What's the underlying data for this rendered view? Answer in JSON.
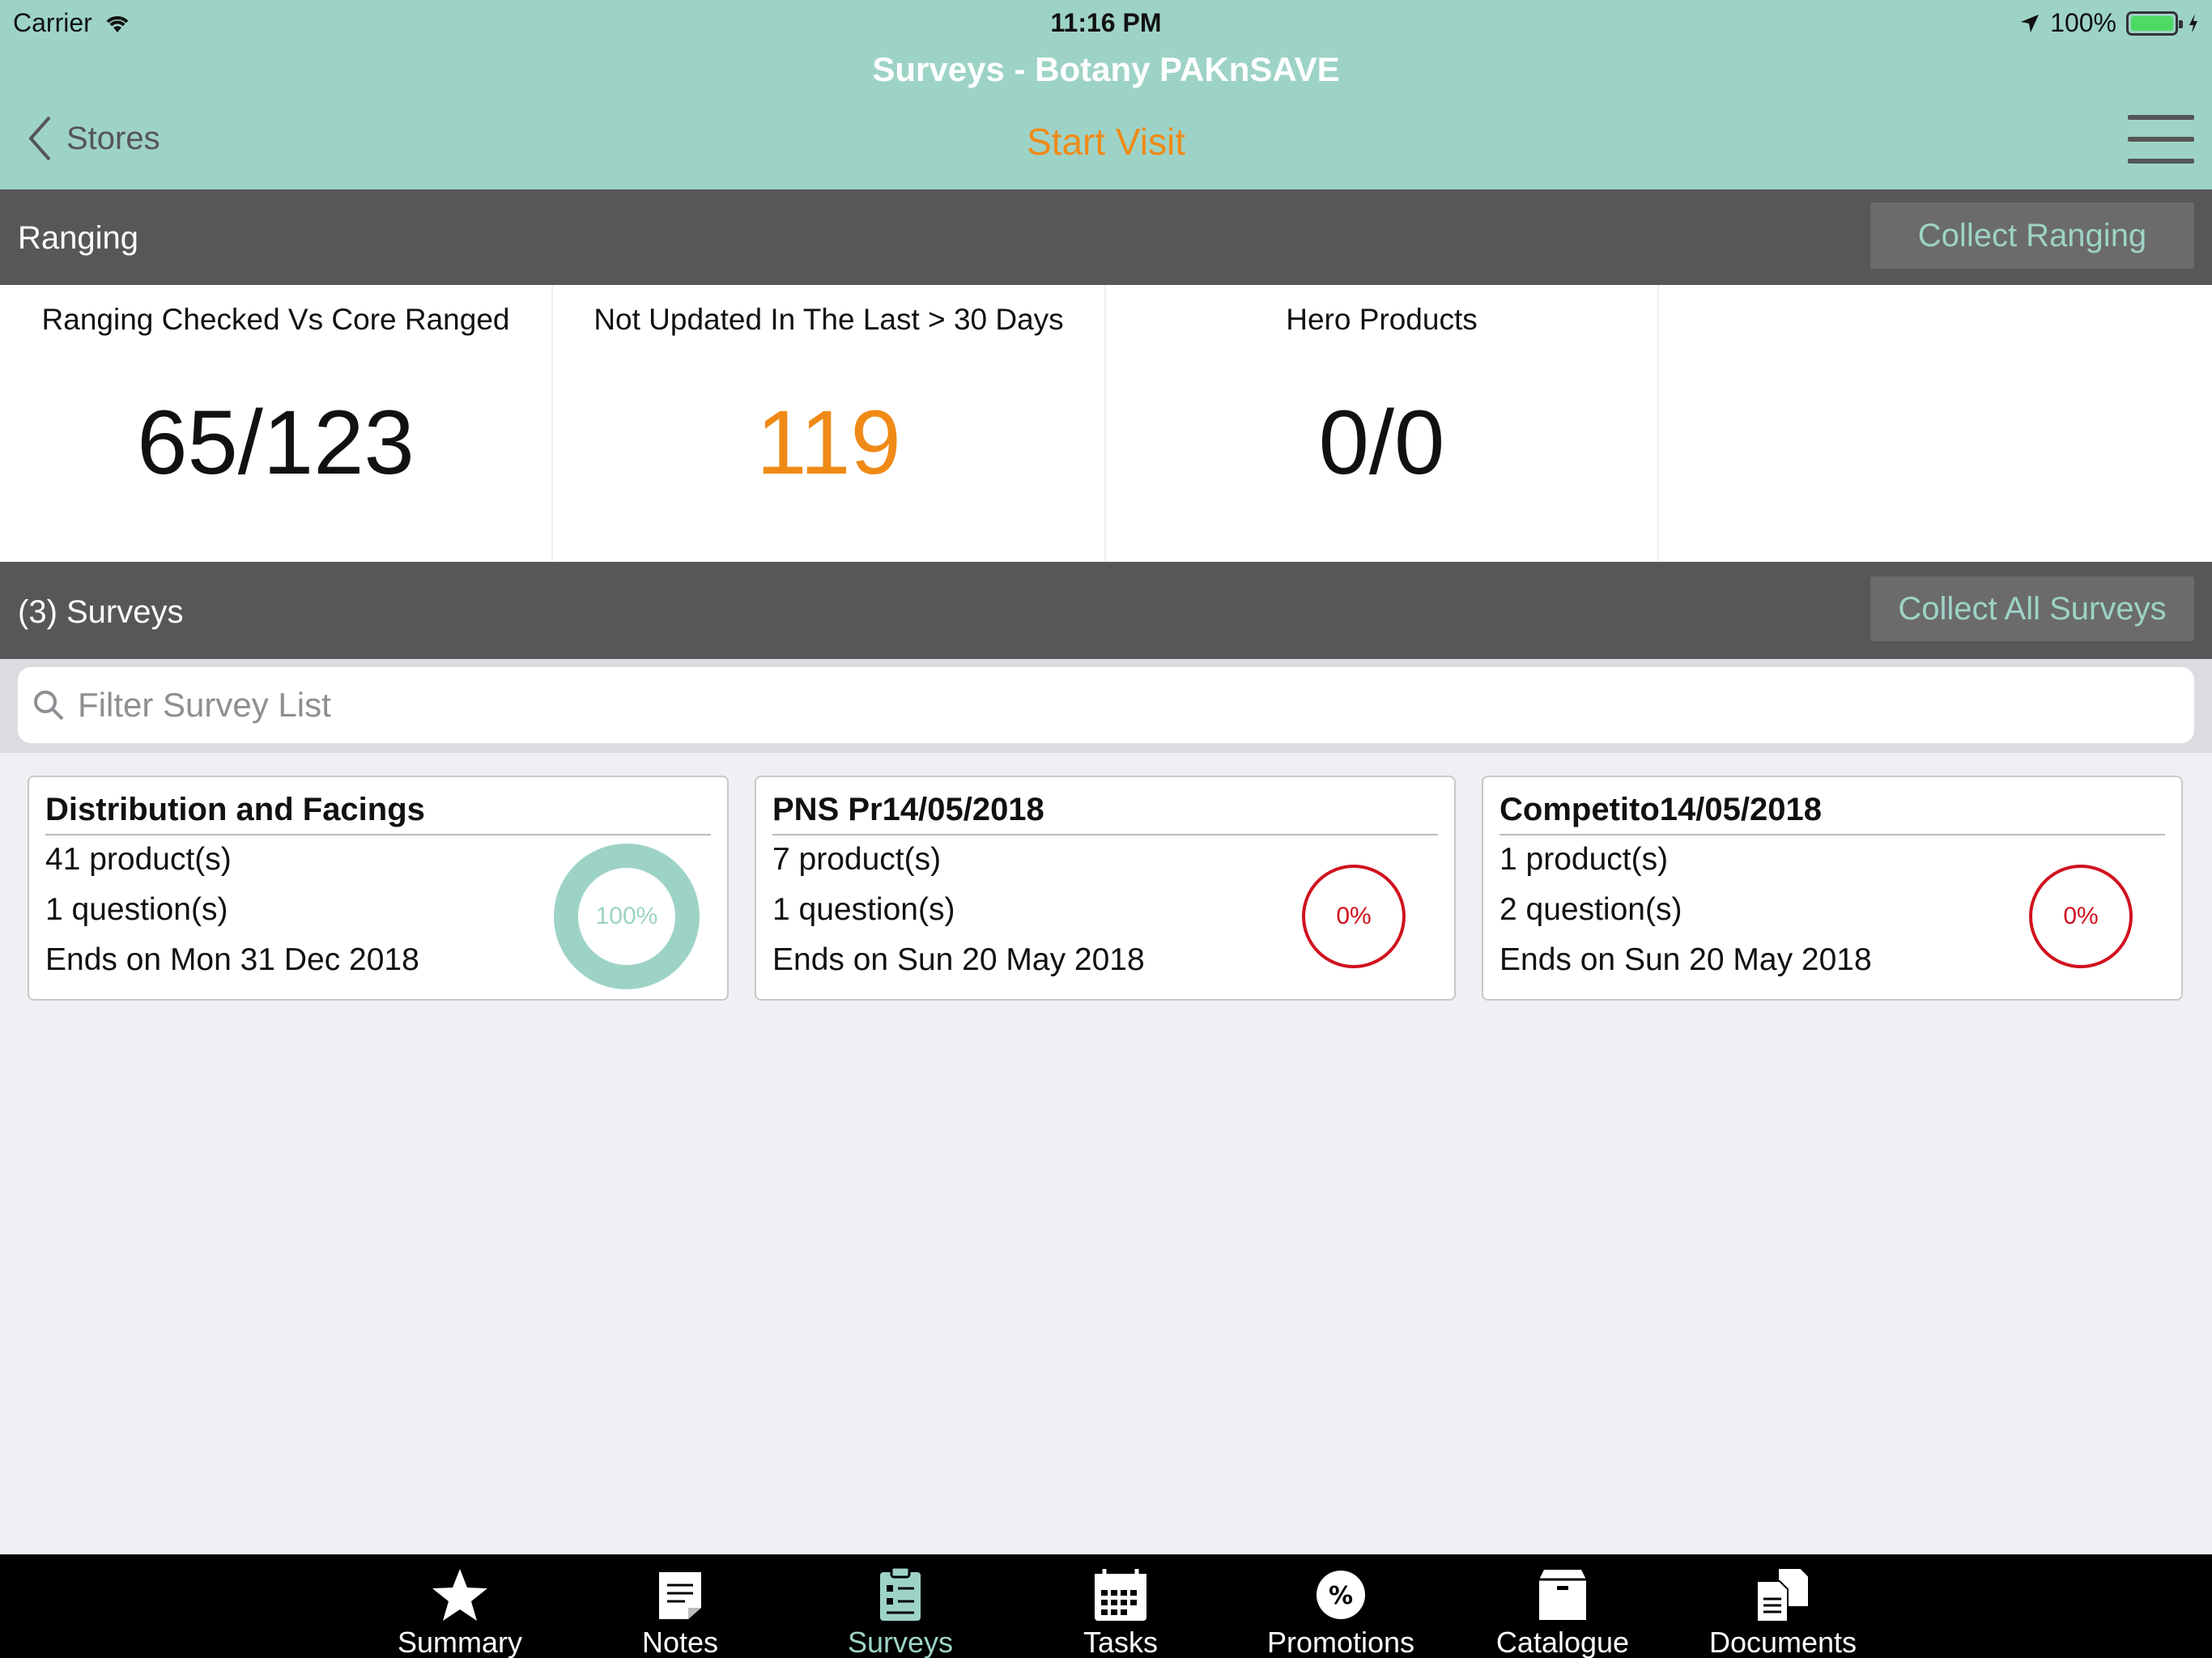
{
  "status_bar": {
    "carrier": "Carrier",
    "time": "11:16 PM",
    "battery": "100%"
  },
  "nav": {
    "title": "Surveys - Botany PAKnSAVE",
    "back_label": "Stores",
    "center_action": "Start Visit"
  },
  "ranging": {
    "title": "Ranging",
    "action": "Collect Ranging",
    "metrics": [
      {
        "label": "Ranging Checked Vs Core Ranged",
        "value": "65/123"
      },
      {
        "label": "Not Updated In The Last > 30 Days",
        "value": "119"
      },
      {
        "label": "Hero Products",
        "value": "0/0"
      }
    ]
  },
  "surveys": {
    "title": "(3) Surveys",
    "action": "Collect All Surveys",
    "search_placeholder": "Filter Survey List",
    "cards": [
      {
        "title": "Distribution and Facings",
        "products": "41 product(s)",
        "questions": "1 question(s)",
        "ends": "Ends on Mon 31 Dec 2018",
        "progress_label": "100%",
        "progress": 1.0
      },
      {
        "title": "PNS Pr14/05/2018",
        "products": "7 product(s)",
        "questions": "1 question(s)",
        "ends": "Ends on Sun 20 May 2018",
        "progress_label": "0%",
        "progress": 0
      },
      {
        "title": "Competito14/05/2018",
        "products": "1 product(s)",
        "questions": "2 question(s)",
        "ends": "Ends on Sun 20 May 2018",
        "progress_label": "0%",
        "progress": 0
      }
    ]
  },
  "tabs": [
    {
      "label": "Summary",
      "icon": "star-icon"
    },
    {
      "label": "Notes",
      "icon": "note-icon"
    },
    {
      "label": "Surveys",
      "icon": "clipboard-icon",
      "active": true
    },
    {
      "label": "Tasks",
      "icon": "calendar-icon"
    },
    {
      "label": "Promotions",
      "icon": "percent-badge-icon"
    },
    {
      "label": "Catalogue",
      "icon": "box-icon"
    },
    {
      "label": "Documents",
      "icon": "documents-icon"
    }
  ],
  "colors": {
    "accent": "#9dd3c6",
    "orange": "#f08a17",
    "danger": "#d0121e",
    "section_bar": "#575757"
  }
}
